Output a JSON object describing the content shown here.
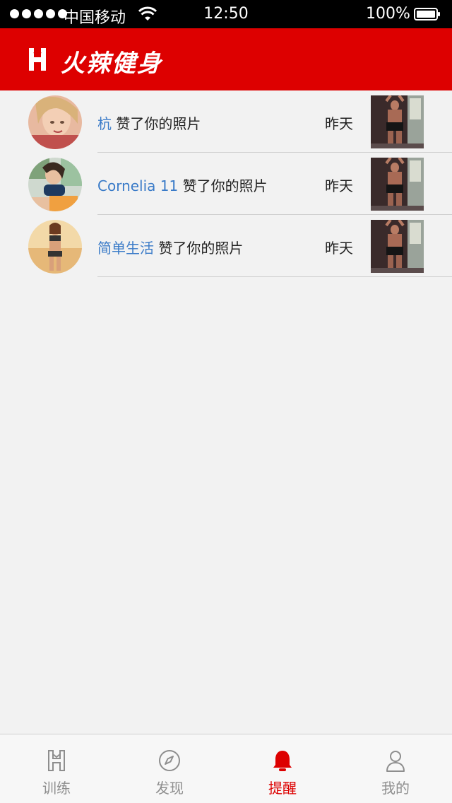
{
  "status_bar": {
    "carrier": "中国移动",
    "time": "12:50",
    "battery": "100%"
  },
  "header": {
    "title": "火辣健身",
    "logo_icon": "brand-h-logo-icon"
  },
  "notifications": [
    {
      "user": "杭",
      "action": "赞了你的照片",
      "time": "昨天",
      "avatar_icon": "user-avatar",
      "thumb_icon": "liked-photo-thumbnail"
    },
    {
      "user": "Cornelia 11",
      "action": "赞了你的照片",
      "time": "昨天",
      "avatar_icon": "user-avatar",
      "thumb_icon": "liked-photo-thumbnail"
    },
    {
      "user": "简单生活",
      "action": "赞了你的照片",
      "time": "昨天",
      "avatar_icon": "user-avatar",
      "thumb_icon": "liked-photo-thumbnail"
    }
  ],
  "tabbar": {
    "tabs": [
      {
        "label": "训练",
        "icon": "brand-h-icon",
        "active": false
      },
      {
        "label": "发现",
        "icon": "compass-icon",
        "active": false
      },
      {
        "label": "提醒",
        "icon": "bell-icon",
        "active": true
      },
      {
        "label": "我的",
        "icon": "person-icon",
        "active": false
      }
    ]
  },
  "colors": {
    "brand_red": "#dd0000",
    "link_blue": "#3a7bc8",
    "background": "#f2f2f2",
    "inactive_gray": "#8e8e8e"
  }
}
